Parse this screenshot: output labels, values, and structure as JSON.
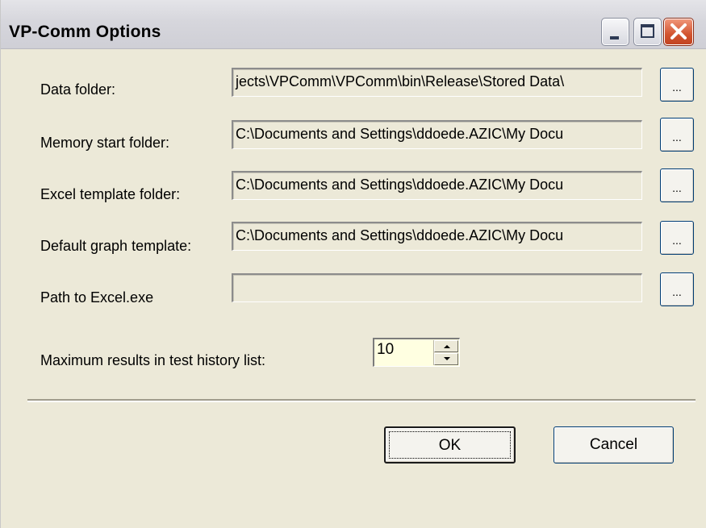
{
  "window": {
    "title": "VP-Comm Options",
    "colors": {
      "face": "#ece9d8",
      "spinner_bg": "#ffffe1",
      "close_button": "#d2542f",
      "button_border": "#003c74"
    }
  },
  "title_buttons": {
    "minimize_icon": "minimize-icon",
    "maximize_icon": "maximize-icon",
    "close_icon": "close-icon"
  },
  "folders": [
    {
      "label": "Data folder:",
      "value": "jects\\VPComm\\VPComm\\bin\\Release\\Stored Data\\",
      "browse_label": "..."
    },
    {
      "label": "Memory start folder:",
      "value": "C:\\Documents and Settings\\ddoede.AZIC\\My Docu",
      "browse_label": "..."
    },
    {
      "label": "Excel template folder:",
      "value": "C:\\Documents and Settings\\ddoede.AZIC\\My Docu",
      "browse_label": "..."
    },
    {
      "label": "Default graph template:",
      "value": "C:\\Documents and Settings\\ddoede.AZIC\\My Docu",
      "browse_label": "..."
    },
    {
      "label": "Path to Excel.exe",
      "value": "",
      "browse_label": "..."
    }
  ],
  "history": {
    "label": "Maximum results in test history list:",
    "value": "10"
  },
  "buttons": {
    "ok_label": "OK",
    "cancel_label": "Cancel"
  }
}
